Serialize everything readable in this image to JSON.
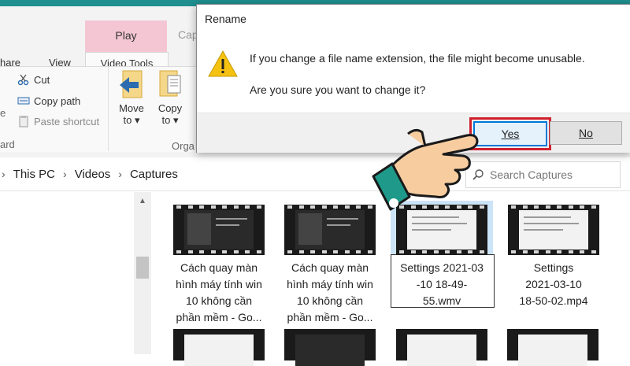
{
  "ribbon": {
    "context_tab": "Play",
    "tabs": [
      "hare",
      "View",
      "Video Tools"
    ],
    "captures_tab_partial": "Cap",
    "clipboard": {
      "cut": "Cut",
      "copy_path": "Copy path",
      "paste_shortcut": "Paste shortcut",
      "left_partial_e": "e",
      "group_partial": "ard"
    },
    "organize": {
      "move_to_1": "Move",
      "move_to_2": "to ▾",
      "copy_to_1": "Copy",
      "copy_to_2": "to ▾",
      "group_partial": "Orga"
    }
  },
  "address": {
    "crumbs": [
      "This PC",
      "Videos",
      "Captures"
    ],
    "search_placeholder": "Search Captures"
  },
  "files": [
    {
      "name": "Cách quay màn\nhình máy tính win\n10 không cần\nphần mềm - Go...",
      "frame": "dark"
    },
    {
      "name": "Cách quay màn\nhình máy tính win\n10 không cần\nphần mềm - Go...",
      "frame": "dark"
    },
    {
      "name": "Settings 2021-03\n-10 18-49-\n55.wmv",
      "frame": "light",
      "selected": true
    },
    {
      "name": "Settings\n2021-03-10\n18-50-02.mp4",
      "frame": "light"
    }
  ],
  "dialog": {
    "title": "Rename",
    "message1": "If you change a file name extension, the file might become unusable.",
    "message2": "Are you sure you want to change it?",
    "yes": "Yes",
    "no": "No"
  },
  "colors": {
    "accent": "#0078d7",
    "highlight": "#d0202e",
    "selection": "#cce4f7",
    "context_tab": "#f4c6d4"
  }
}
